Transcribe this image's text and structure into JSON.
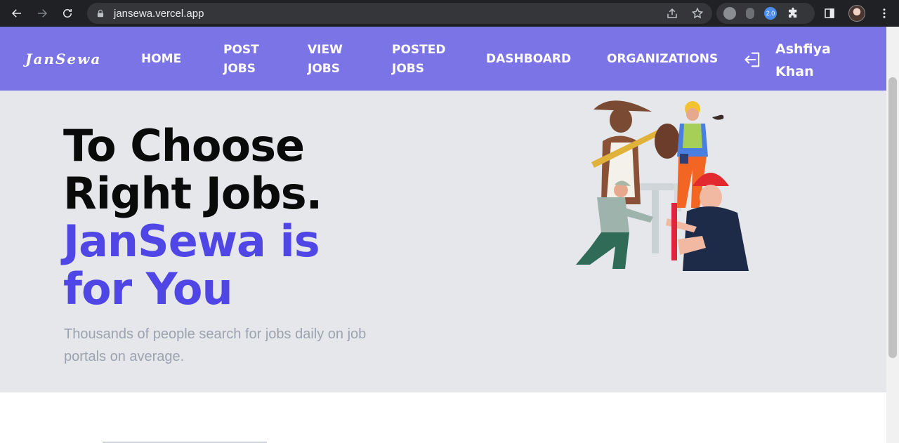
{
  "browser": {
    "url": "jansewa.vercel.app",
    "extension_badge": "2.0"
  },
  "site": {
    "logo": "JanSewa",
    "nav": [
      {
        "line1": "HOME",
        "line2": ""
      },
      {
        "line1": "POST",
        "line2": "JOBS"
      },
      {
        "line1": "VIEW",
        "line2": "JOBS"
      },
      {
        "line1": "POSTED",
        "line2": "JOBS"
      },
      {
        "line1": "DASHBOARD",
        "line2": ""
      },
      {
        "line1": "ORGANIZATIONS",
        "line2": ""
      }
    ],
    "user": {
      "first": "Ashfiya",
      "last": "Khan"
    }
  },
  "hero": {
    "line1": "To Choose",
    "line2": "Right Jobs.",
    "line3": "JanSewa is",
    "line4": "for You",
    "subtitle_line1": "Thousands of people search for jobs daily on job",
    "subtitle_line2": "portals on average."
  },
  "colors": {
    "nav_bg": "#7b74e6",
    "hero_bg": "#e5e7eb",
    "accent": "#4f46e5"
  }
}
